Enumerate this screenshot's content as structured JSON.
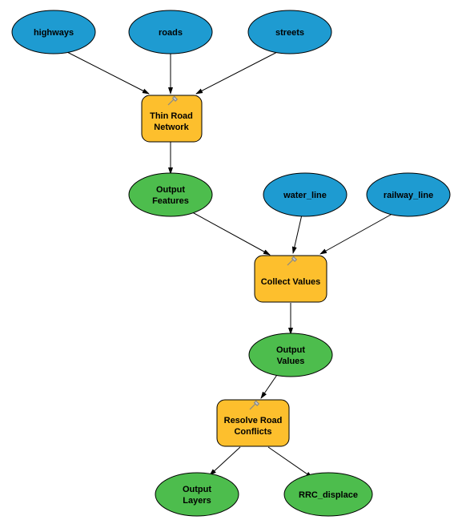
{
  "nodes": {
    "highways": {
      "label": "highways"
    },
    "roads": {
      "label": "roads"
    },
    "streets": {
      "label": "streets"
    },
    "thin_road": {
      "line1": "Thin Road",
      "line2": "Network"
    },
    "output_features": {
      "line1": "Output",
      "line2": "Features"
    },
    "water_line": {
      "label": "water_line"
    },
    "railway_line": {
      "label": "railway_line"
    },
    "collect_values": {
      "label": "Collect Values"
    },
    "output_values": {
      "line1": "Output",
      "line2": "Values"
    },
    "resolve_road": {
      "line1": "Resolve Road",
      "line2": "Conflicts"
    },
    "output_layers": {
      "line1": "Output",
      "line2": "Layers"
    },
    "rrc_displace": {
      "label": "RRC_displace"
    }
  }
}
